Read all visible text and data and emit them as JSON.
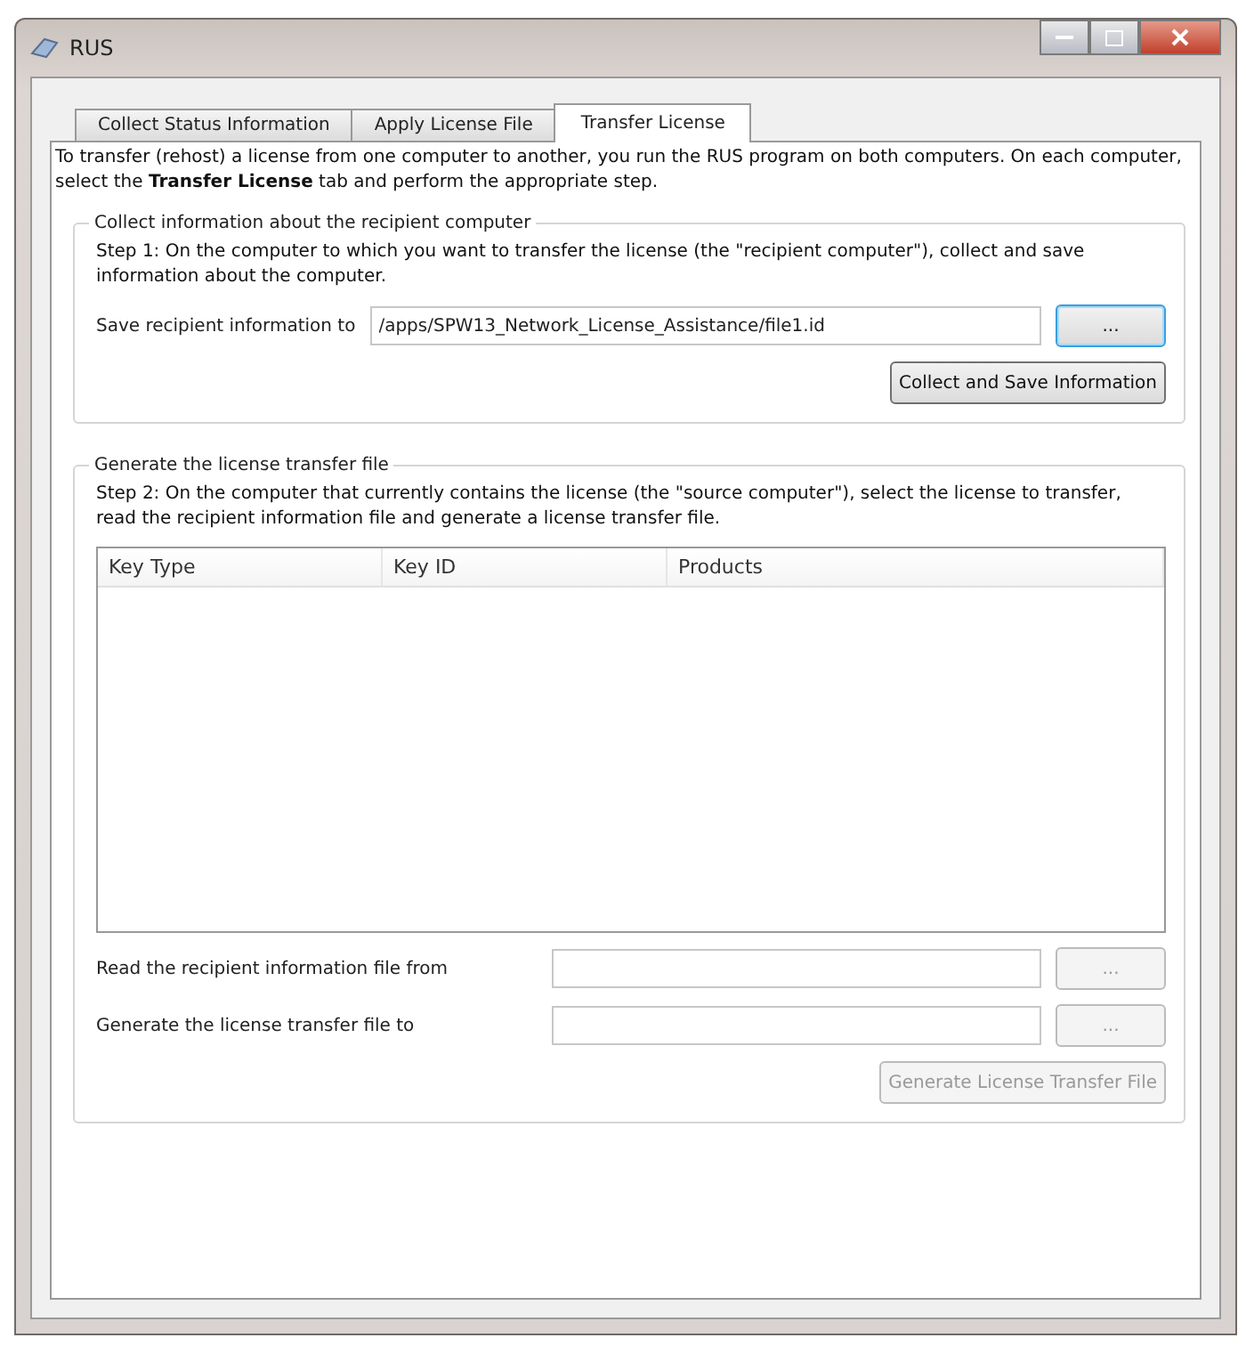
{
  "window": {
    "title": "RUS"
  },
  "tabs": [
    {
      "label": "Collect Status Information",
      "selected": false
    },
    {
      "label": "Apply License File",
      "selected": false
    },
    {
      "label": "Transfer License",
      "selected": true
    }
  ],
  "intro": "To transfer (rehost) a license from one computer to another, you run the RUS program on both computers. On each computer, select the **Transfer License** tab and perform the appropriate step.",
  "collect_section": {
    "title": "Collect information about the recipient computer",
    "step": "Step 1: On the computer to which you want to transfer the license (the \"recipient computer\"), collect and save information about the computer.",
    "save_label": "Save recipient information to",
    "save_value": "/apps/SPW13_Network_License_Assistance/file1.id",
    "browse": {
      "label": "...",
      "disabled": false,
      "focused": true
    },
    "action": {
      "label": "Collect and Save Information",
      "disabled": false
    }
  },
  "generate_section": {
    "title": "Generate the license transfer file",
    "step": "Step 2: On the computer that currently contains the license (the \"source computer\"), select the license to transfer, read the recipient information file and generate a license transfer file.",
    "table": {
      "columns": [
        "Key Type",
        "Key ID",
        "Products"
      ]
    },
    "read_label": "Read the recipient information file from",
    "read_browse": {
      "label": "...",
      "disabled": true,
      "focused": false
    },
    "gen_label": "Generate the license transfer file to",
    "gen_browse": {
      "label": "...",
      "disabled": true,
      "focused": false
    },
    "action": {
      "label": "Generate License Transfer File",
      "disabled": true
    }
  }
}
